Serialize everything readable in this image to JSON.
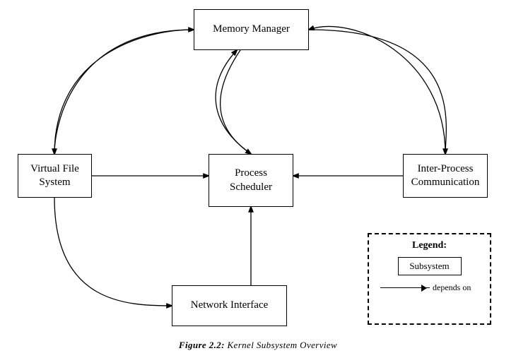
{
  "boxes": {
    "memory": {
      "label": "Memory Manager"
    },
    "process": {
      "label": "Process\nScheduler"
    },
    "vfs": {
      "label": "Virtual File\nSystem"
    },
    "ipc": {
      "label": "Inter-Process\nCommunication"
    },
    "network": {
      "label": "Network Interface"
    }
  },
  "legend": {
    "title": "Legend:",
    "subsystem_label": "Subsystem",
    "arrow_label": "depends on"
  },
  "caption": "Figure 2.2: Kernel Subsystem Overview"
}
